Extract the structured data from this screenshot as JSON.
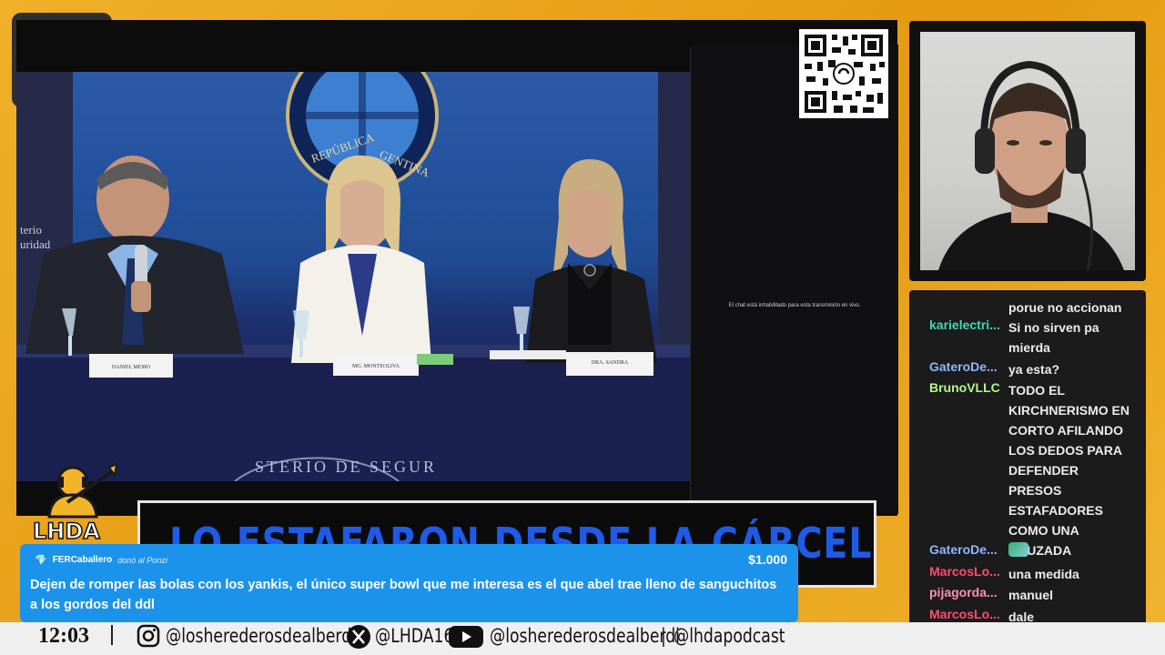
{
  "video": {
    "chat_disabled_text": "El chat está inhabilitado para esta transmisión en vivo."
  },
  "lower_third": {
    "headline": "LO ESTAFARON DESDE LA CÁRCEL",
    "badge": "LHDA"
  },
  "donation": {
    "donor": "FERCaballero",
    "action": "donó al Ponzi",
    "amount": "$1.000",
    "message": "Dejen de romper las bolas con los yankis, el único super bowl que me interesa es el que abel trae lleno de sanguchitos a los gordos del ddl"
  },
  "side_chat": {
    "messages": [
      {
        "user": "",
        "color": "#ffffff",
        "text": "porue no accionan"
      },
      {
        "user": "karielectri...",
        "color": "#3dd9b0",
        "text": "Si no sirven pa mierda"
      },
      {
        "user": "GateroDe...",
        "color": "#8fb7ff",
        "text": "ya esta?"
      },
      {
        "user": "BrunoVLLC",
        "color": "#b4f58a",
        "text": "TODO EL KIRCHNERISMO EN CORTO AFILANDO LOS DEDOS PARA DEFENDER PRESOS ESTAFADORES COMO UNA CRUZADA"
      },
      {
        "user": "GateroDe...",
        "color": "#8fb7ff",
        "text": ""
      },
      {
        "user": "MarcosLo...",
        "color": "#ff4d6d",
        "text": "una medida"
      },
      {
        "user": "pijagorda...",
        "color": "#ff8fb0",
        "text": "manuel"
      },
      {
        "user": "MarcosLo...",
        "color": "#ff4d6d",
        "text": "dale"
      }
    ]
  },
  "bottom_bar": {
    "clock": "12:03",
    "instagram": "@losherederosdealberdi",
    "x": "@LHDA16",
    "youtube": "@losherederosdealberdi",
    "tiktok_sep": "|",
    "podcast": "@lhdapodcast"
  },
  "colors": {
    "accent": "#e9a21a",
    "headline_blue": "#1e5be8",
    "donation_blue": "#1c93ea"
  }
}
